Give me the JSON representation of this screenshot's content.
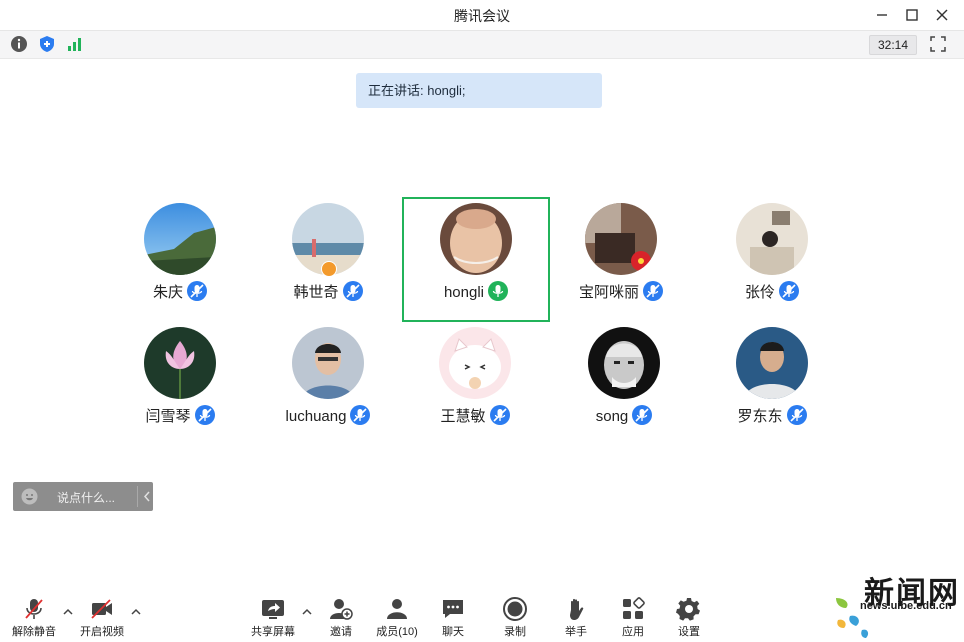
{
  "window": {
    "title": "腾讯会议"
  },
  "info": {
    "timer": "32:14"
  },
  "banner": {
    "speaking": "正在讲话: hongli;"
  },
  "participants": [
    {
      "name": "朱庆",
      "mic": "muted"
    },
    {
      "name": "韩世奇",
      "mic": "muted"
    },
    {
      "name": "hongli",
      "mic": "speaking"
    },
    {
      "name": "宝阿咪丽",
      "mic": "muted"
    },
    {
      "name": "张伶",
      "mic": "muted"
    },
    {
      "name": "闫雪琴",
      "mic": "muted"
    },
    {
      "name": "luchuang",
      "mic": "muted"
    },
    {
      "name": "王慧敏",
      "mic": "muted"
    },
    {
      "name": "song",
      "mic": "muted"
    },
    {
      "name": "罗东东",
      "mic": "muted"
    }
  ],
  "chat": {
    "placeholder": "说点什么..."
  },
  "toolbar": {
    "unmute": "解除静音",
    "video": "开启视频",
    "share": "共享屏幕",
    "invite": "邀请",
    "members": "成员(10)",
    "chat": "聊天",
    "record": "录制",
    "raise_hand": "举手",
    "apps": "应用",
    "settings": "设置"
  },
  "watermark": {
    "logo": "新闻网",
    "url": "news.uibe.edu.cn"
  },
  "colors": {
    "accent": "#2b7cf0",
    "speaking": "#21b35a",
    "banner": "#d6e6f9"
  }
}
